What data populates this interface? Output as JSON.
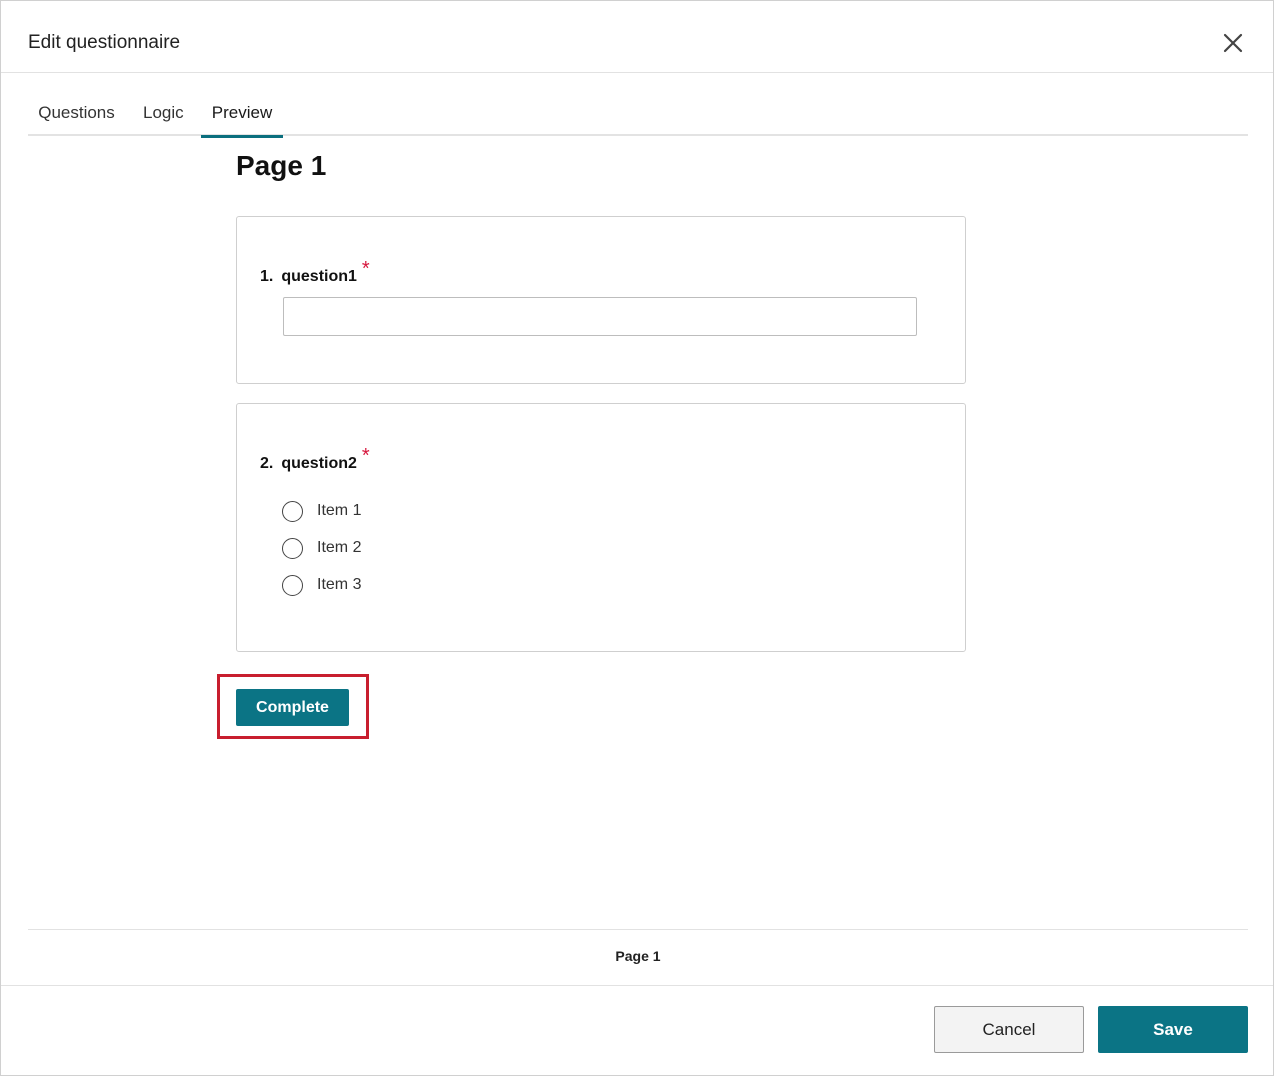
{
  "dialog": {
    "title": "Edit questionnaire"
  },
  "tabs": [
    {
      "label": "Questions",
      "active": false
    },
    {
      "label": "Logic",
      "active": false
    },
    {
      "label": "Preview",
      "active": true
    }
  ],
  "preview": {
    "page_heading": "Page 1",
    "questions": [
      {
        "number": "1.",
        "name": "question1",
        "required_marker": "*",
        "type": "text",
        "value": "",
        "placeholder": ""
      },
      {
        "number": "2.",
        "name": "question2",
        "required_marker": "*",
        "type": "radio",
        "options": [
          "Item 1",
          "Item 2",
          "Item 3"
        ]
      }
    ],
    "complete_label": "Complete"
  },
  "pagination": {
    "current_page_label": "Page 1"
  },
  "actions": {
    "cancel_label": "Cancel",
    "save_label": "Save"
  },
  "colors": {
    "accent": "#0b7485",
    "required": "#d6173d",
    "highlight": "#c81e2e"
  },
  "icons": {
    "close": "close-icon"
  }
}
